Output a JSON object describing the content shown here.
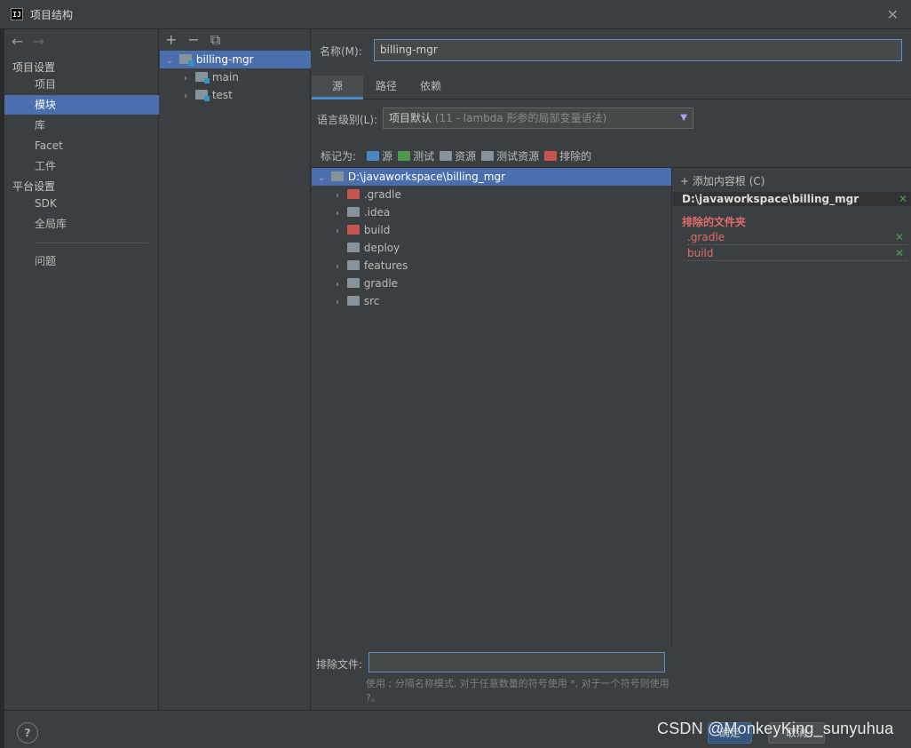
{
  "window": {
    "title": "项目结构",
    "close": "✕",
    "logo": "IJ"
  },
  "sidebar": {
    "back": "←",
    "forward": "→",
    "project_settings": "项目设置",
    "items_top": [
      "项目",
      "模块",
      "库",
      "Facet",
      "工件"
    ],
    "platform_settings": "平台设置",
    "items_platform": [
      "SDK",
      "全局库"
    ],
    "problems": "问题"
  },
  "modules": {
    "toolbar": {
      "add": "+",
      "remove": "−",
      "copy": "⧉"
    },
    "root": "billing-mgr",
    "children": [
      "main",
      "test"
    ]
  },
  "main": {
    "name_label": "名称(M):",
    "name_value": "billing-mgr",
    "tabs": [
      "源",
      "路径",
      "依赖"
    ],
    "lang_label": "语言级别(L):",
    "lang_value": "项目默认",
    "lang_detail": "(11 - lambda 形参的局部变量语法)",
    "mark_label": "标记为:",
    "marks": [
      "源",
      "测试",
      "资源",
      "测试资源",
      "排除的"
    ],
    "tree_root": "D:\\javaworkspace\\billing_mgr",
    "tree_items": [
      ".gradle",
      ".idea",
      "build",
      "deploy",
      "features",
      "gradle",
      "src"
    ],
    "exclude_files_label": "排除文件:",
    "exclude_hint": "使用 ; 分隔名称模式, 对于任意数量的符号使用 *, 对于一个符号则使用 ?。"
  },
  "roots_panel": {
    "add_root": "添加内容根 (C)",
    "root_path": "D:\\javaworkspace\\billing_mgr",
    "excluded_title": "排除的文件夹",
    "excluded": [
      ".gradle",
      "build"
    ],
    "remove": "✕"
  },
  "footer": {
    "help": "?",
    "ok": "确定",
    "cancel": "取消",
    "watermark": "CSDN @MonkeyKing_sunyuhua"
  }
}
